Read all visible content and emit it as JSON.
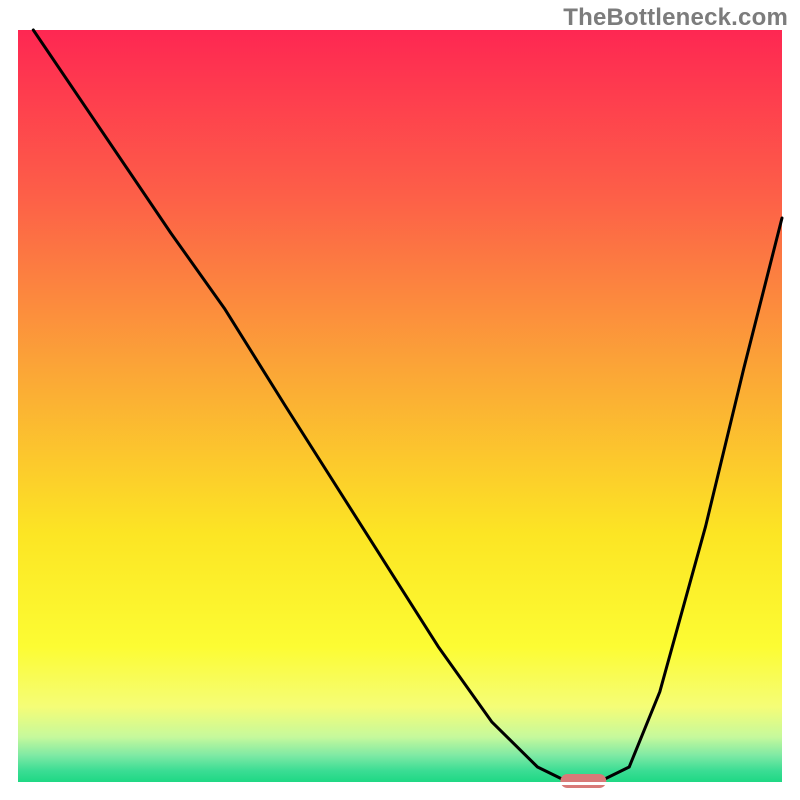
{
  "watermark": "TheBottleneck.com",
  "chart_data": {
    "type": "line",
    "title": "",
    "xlabel": "",
    "ylabel": "",
    "xlim": [
      0,
      100
    ],
    "ylim": [
      0,
      100
    ],
    "grid": false,
    "legend": false,
    "series": [
      {
        "name": "bottleneck-curve",
        "color": "#000000",
        "x": [
          2,
          10,
          20,
          27,
          35,
          45,
          55,
          62,
          68,
          72,
          76,
          80,
          84,
          90,
          95,
          100
        ],
        "y": [
          100,
          88,
          73,
          63,
          50,
          34,
          18,
          8,
          2,
          0,
          0,
          2,
          12,
          34,
          55,
          75
        ]
      }
    ],
    "marker": {
      "name": "optimal-range",
      "x_center": 74,
      "y": 0,
      "width": 6,
      "color": "#d87a78"
    },
    "background_gradient": {
      "stops": [
        {
          "offset": 0.0,
          "color": "#fe2752"
        },
        {
          "offset": 0.22,
          "color": "#fd5f48"
        },
        {
          "offset": 0.45,
          "color": "#fba537"
        },
        {
          "offset": 0.67,
          "color": "#fce524"
        },
        {
          "offset": 0.82,
          "color": "#fcfc33"
        },
        {
          "offset": 0.9,
          "color": "#f5fd77"
        },
        {
          "offset": 0.94,
          "color": "#c6f99c"
        },
        {
          "offset": 0.965,
          "color": "#7de9a4"
        },
        {
          "offset": 0.985,
          "color": "#3bdd94"
        },
        {
          "offset": 1.0,
          "color": "#1ed884"
        }
      ]
    }
  }
}
